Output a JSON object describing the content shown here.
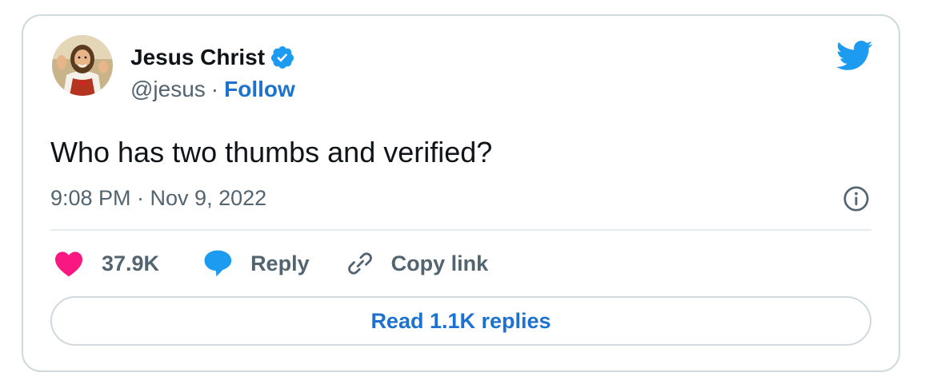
{
  "author": {
    "display_name": "Jesus Christ",
    "handle": "@jesus",
    "separator": "·",
    "follow_label": "Follow",
    "verified": true
  },
  "tweet": {
    "text": "Who has two thumbs and verified?",
    "timestamp": "9:08 PM · Nov 9, 2022"
  },
  "actions": {
    "like_count": "37.9K",
    "reply_label": "Reply",
    "copy_link_label": "Copy link"
  },
  "read_replies_label": "Read 1.1K replies",
  "icons": {
    "avatar": "avatar-image",
    "verified": "verified-badge-icon",
    "brand": "twitter-bird-icon",
    "info": "info-icon",
    "like": "heart-icon",
    "reply": "speech-bubble-icon",
    "copy": "link-icon"
  },
  "colors": {
    "brand_blue": "#1d9bf0",
    "link_blue": "#1d72d0",
    "like_pink": "#f91880",
    "text_primary": "#0f1419",
    "text_secondary": "#536471",
    "border": "#cfd9de"
  }
}
